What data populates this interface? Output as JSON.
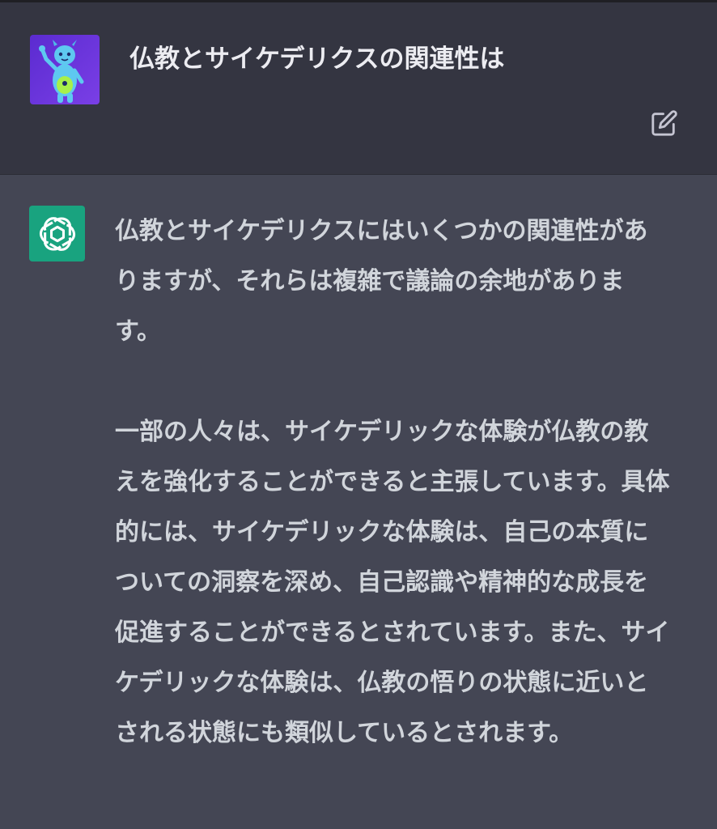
{
  "user_message": {
    "text": "仏教とサイケデリクスの関連性は",
    "avatar_icon": "cartoon-creature-avatar-icon",
    "edit_icon": "edit-pencil-icon"
  },
  "assistant_message": {
    "avatar_icon": "openai-logo-icon",
    "paragraphs": [
      "仏教とサイケデリクスにはいくつかの関連性がありますが、それらは複雑で議論の余地があります。",
      "一部の人々は、サイケデリックな体験が仏教の教えを強化することができると主張しています。具体的には、サイケデリックな体験は、自己の本質についての洞察を深め、自己認識や精神的な成長を促進することができるとされています。また、サイケデリックな体験は、仏教の悟りの状態に近いとされる状態にも類似しているとされます。"
    ]
  },
  "colors": {
    "user_bg": "#343541",
    "assistant_bg": "#444654",
    "text": "#d1d5db",
    "accent": "#19a37f"
  }
}
